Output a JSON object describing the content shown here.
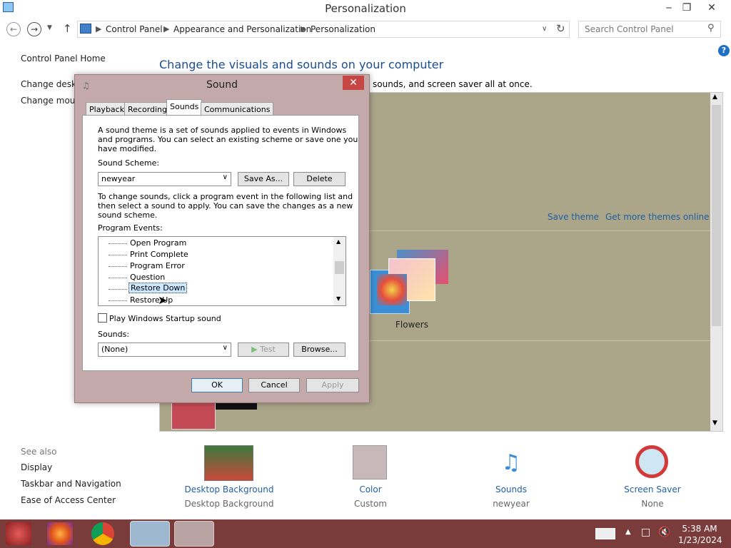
{
  "window": {
    "title": "Personalization",
    "icons": {
      "minimize": "‒",
      "restore": "❐",
      "close": "✕"
    }
  },
  "nav": {
    "breadcrumb": [
      "Control Panel",
      "Appearance and Personalization",
      "Personalization"
    ],
    "search_placeholder": "Search Control Panel"
  },
  "left_pane": {
    "home": "Control Panel Home",
    "links": [
      "Change deskto",
      "Change mous"
    ],
    "see_also_title": "See also",
    "see_also": [
      "Display",
      "Taskbar and Navigation",
      "Ease of Access Center"
    ]
  },
  "main": {
    "heading": "Change the visuals and sounds on your computer",
    "subtext": "sounds, and screen saver all at once.",
    "save_theme": "Save theme",
    "get_more": "Get more themes online",
    "theme_label": "Flowers"
  },
  "bottom_items": [
    {
      "label": "Desktop Background",
      "sub": "Desktop Background"
    },
    {
      "label": "Color",
      "sub": "Custom"
    },
    {
      "label": "Sounds",
      "sub": "newyear"
    },
    {
      "label": "Screen Saver",
      "sub": "None"
    }
  ],
  "dialog": {
    "title": "Sound",
    "close": "✕",
    "tabs": [
      "Playback",
      "Recording",
      "Sounds",
      "Communications"
    ],
    "description_lines": [
      "A sound theme is a set of sounds applied to events in Windows",
      "and programs.  You can select an existing scheme or save one you",
      "have modified."
    ],
    "scheme_label": "Sound Scheme:",
    "scheme_value": "newyear",
    "save_as": "Save As...",
    "delete": "Delete",
    "instructions_lines": [
      "To change sounds, click a program event in the following list and",
      "then select a sound to apply.  You can save the changes as a new",
      "sound scheme."
    ],
    "events_label": "Program Events:",
    "events": [
      "Open Program",
      "Print Complete",
      "Program Error",
      "Question",
      "Restore Down",
      "Restore Up"
    ],
    "selected_event": "Restore Down",
    "startup_checkbox": "Play Windows Startup sound",
    "startup_checked": false,
    "sounds_label": "Sounds:",
    "sounds_value": "(None)",
    "test": "Test",
    "browse": "Browse...",
    "ok": "OK",
    "cancel": "Cancel",
    "apply": "Apply"
  },
  "taskbar": {
    "time": "5:38 AM",
    "date": "1/23/2024"
  },
  "colors": {
    "link_blue": "#1f5fa3",
    "heading_blue": "#1a4d8f",
    "theme_area": "#aba58a",
    "dialog_frame": "#c3a9a9",
    "close_red": "#c64545",
    "taskbar": "#7a3b3b"
  }
}
